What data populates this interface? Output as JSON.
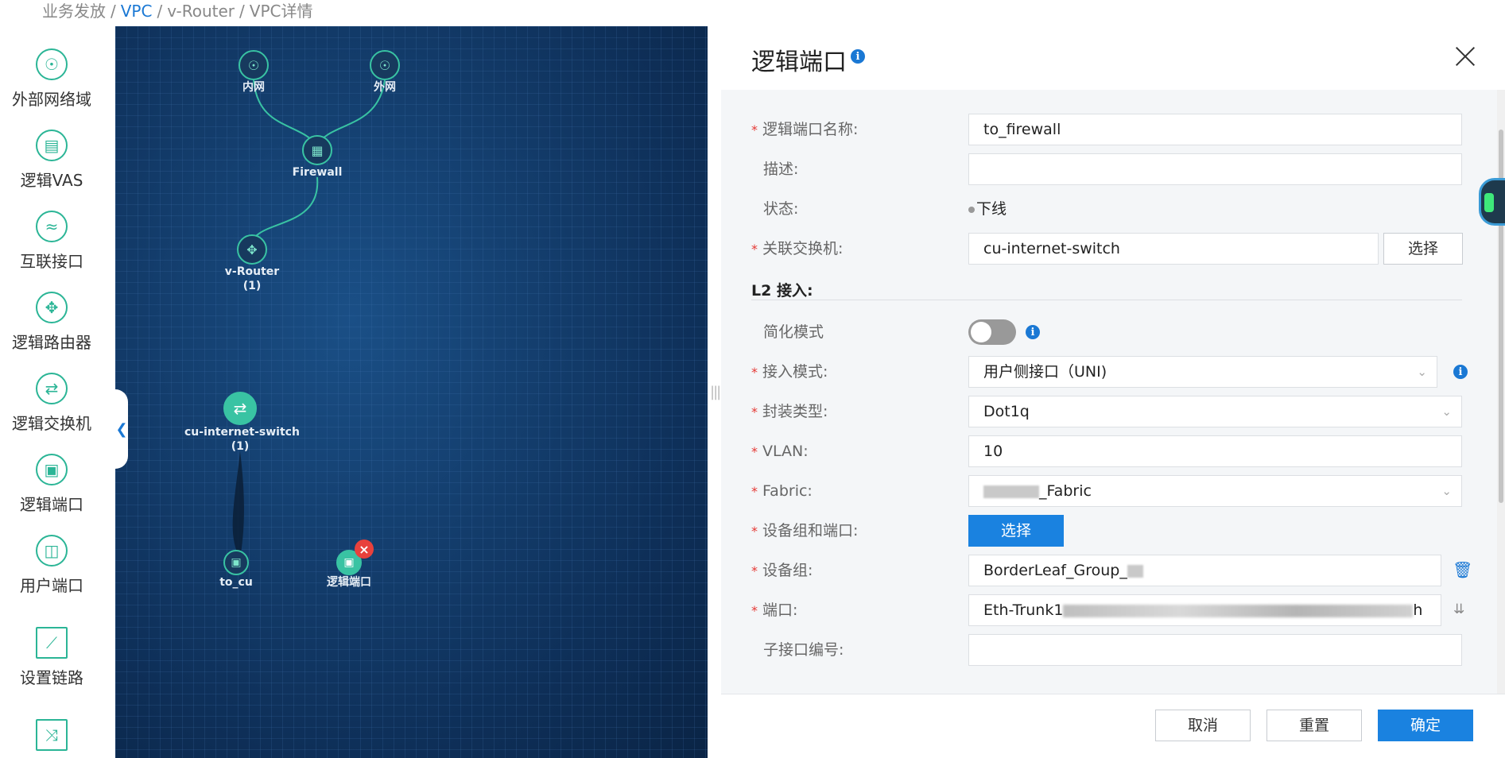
{
  "breadcrumb": {
    "root": "业务发放",
    "sep": "/",
    "vpc": "VPC",
    "router": "v-Router",
    "current": "VPC详情"
  },
  "sidebar": {
    "items": [
      {
        "label": "外部网络域",
        "icon": "globe-icon"
      },
      {
        "label": "逻辑VAS",
        "icon": "vas-icon"
      },
      {
        "label": "互联接口",
        "icon": "interconnect-icon"
      },
      {
        "label": "逻辑路由器",
        "icon": "router-icon"
      },
      {
        "label": "逻辑交换机",
        "icon": "switch-icon"
      },
      {
        "label": "逻辑端口",
        "icon": "port-icon"
      },
      {
        "label": "用户端口",
        "icon": "user-port-icon"
      },
      {
        "label": "设置链路",
        "icon": "link-icon"
      },
      {
        "label": "",
        "icon": "branch-icon"
      }
    ]
  },
  "topology": {
    "nodes": {
      "intranet": "内网",
      "extranet": "外网",
      "firewall": "Firewall",
      "vrouter": "v-Router",
      "vrouter_count": "(1)",
      "switch": "cu-internet-switch",
      "switch_count": "(1)",
      "to_cu": "to_cu",
      "new_port": "逻辑端口"
    },
    "badge_symbol": "×"
  },
  "panel": {
    "title": "逻辑端口",
    "fields": {
      "name_label": "逻辑端口名称:",
      "name_value": "to_firewall",
      "desc_label": "描述:",
      "desc_value": "",
      "status_label": "状态:",
      "status_value": "下线",
      "switch_label": "关联交换机:",
      "switch_value": "cu-internet-switch",
      "select_btn": "选择",
      "l2_section": "L2 接入:",
      "simple_label": "简化模式",
      "access_mode_label": "接入模式:",
      "access_mode_value": "用户侧接口（UNI)",
      "encap_label": "封装类型:",
      "encap_value": "Dot1q",
      "vlan_label": "VLAN:",
      "vlan_value": "10",
      "fabric_label": "Fabric:",
      "fabric_value": "_Fabric",
      "device_port_label": "设备组和端口:",
      "device_port_btn": "选择",
      "device_group_label": "设备组:",
      "device_group_value": "BorderLeaf_Group_",
      "port_label": "端口:",
      "port_value": "Eth-Trunk1",
      "port_value_tail": "h",
      "subif_label": "子接口编号:",
      "subif_value": ""
    },
    "footer": {
      "cancel": "取消",
      "reset": "重置",
      "ok": "确定"
    }
  },
  "colors": {
    "accent": "#1a82e0",
    "node": "#39c3a3",
    "canvas": "#0f3361",
    "required": "#e53935"
  }
}
